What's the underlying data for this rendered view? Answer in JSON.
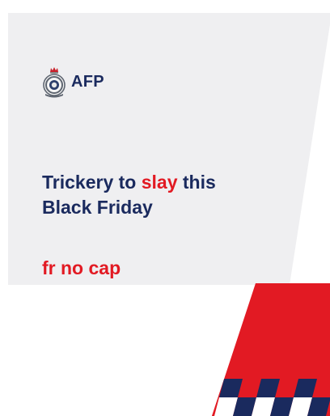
{
  "brand": {
    "logo_text": "AFP",
    "navy": "#1a2a5e",
    "red": "#e21a23",
    "panel_gray": "#efeff1"
  },
  "headline": {
    "part1": "Trickery to ",
    "accent": "slay",
    "part2": " this",
    "line2": "Black Friday"
  },
  "subline": "fr no cap",
  "icons": {
    "crest": "afp-crest-icon"
  }
}
